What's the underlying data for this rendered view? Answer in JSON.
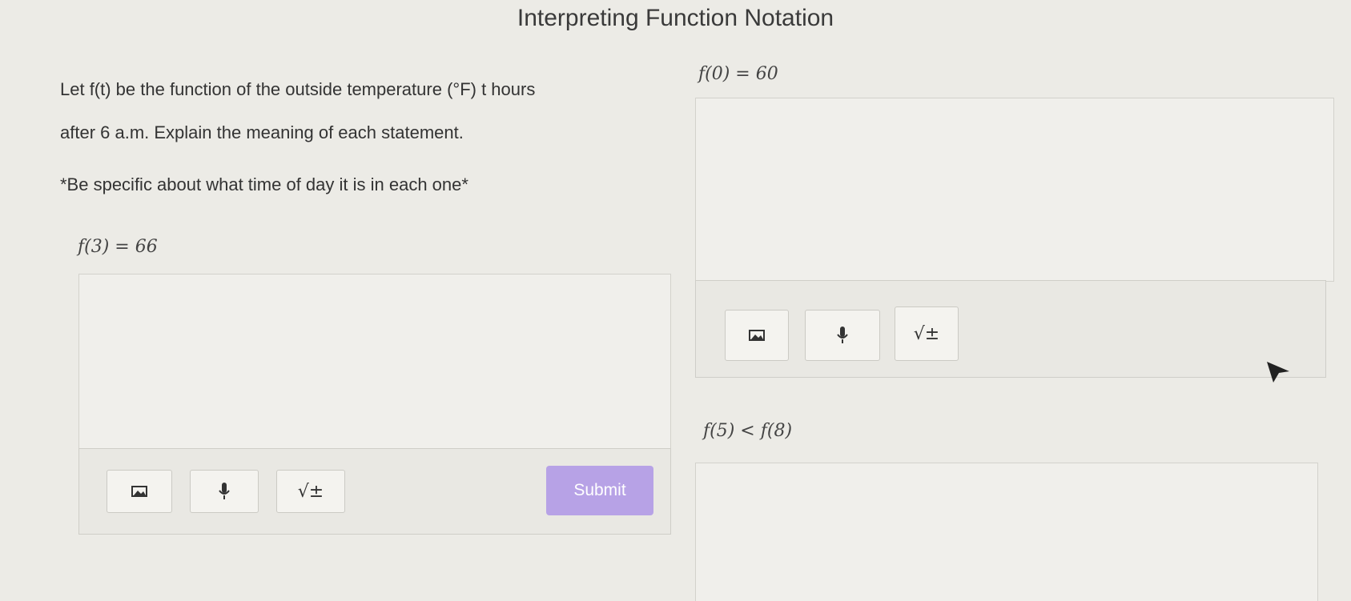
{
  "page": {
    "title": "Interpreting Function Notation"
  },
  "prompt": {
    "line1": "Let f(t) be the function of the outside temperature (°F) t hours",
    "line2": "after 6 a.m. Explain the meaning of each statement.",
    "note": "*Be specific about what time of day it is in each one*"
  },
  "questions": {
    "q1": "f(0) = 60",
    "q2": "f(3) = 66",
    "q3": "f(5) < f(8)"
  },
  "toolbar": {
    "sqrt_label": "√±"
  },
  "actions": {
    "submit_label": "Submit"
  },
  "icons": [
    "image-icon",
    "microphone-icon",
    "math-icon",
    "mouse-cursor-icon"
  ],
  "colors": {
    "submit_bg": "#b7a2e6",
    "background": "#ecebe6"
  }
}
